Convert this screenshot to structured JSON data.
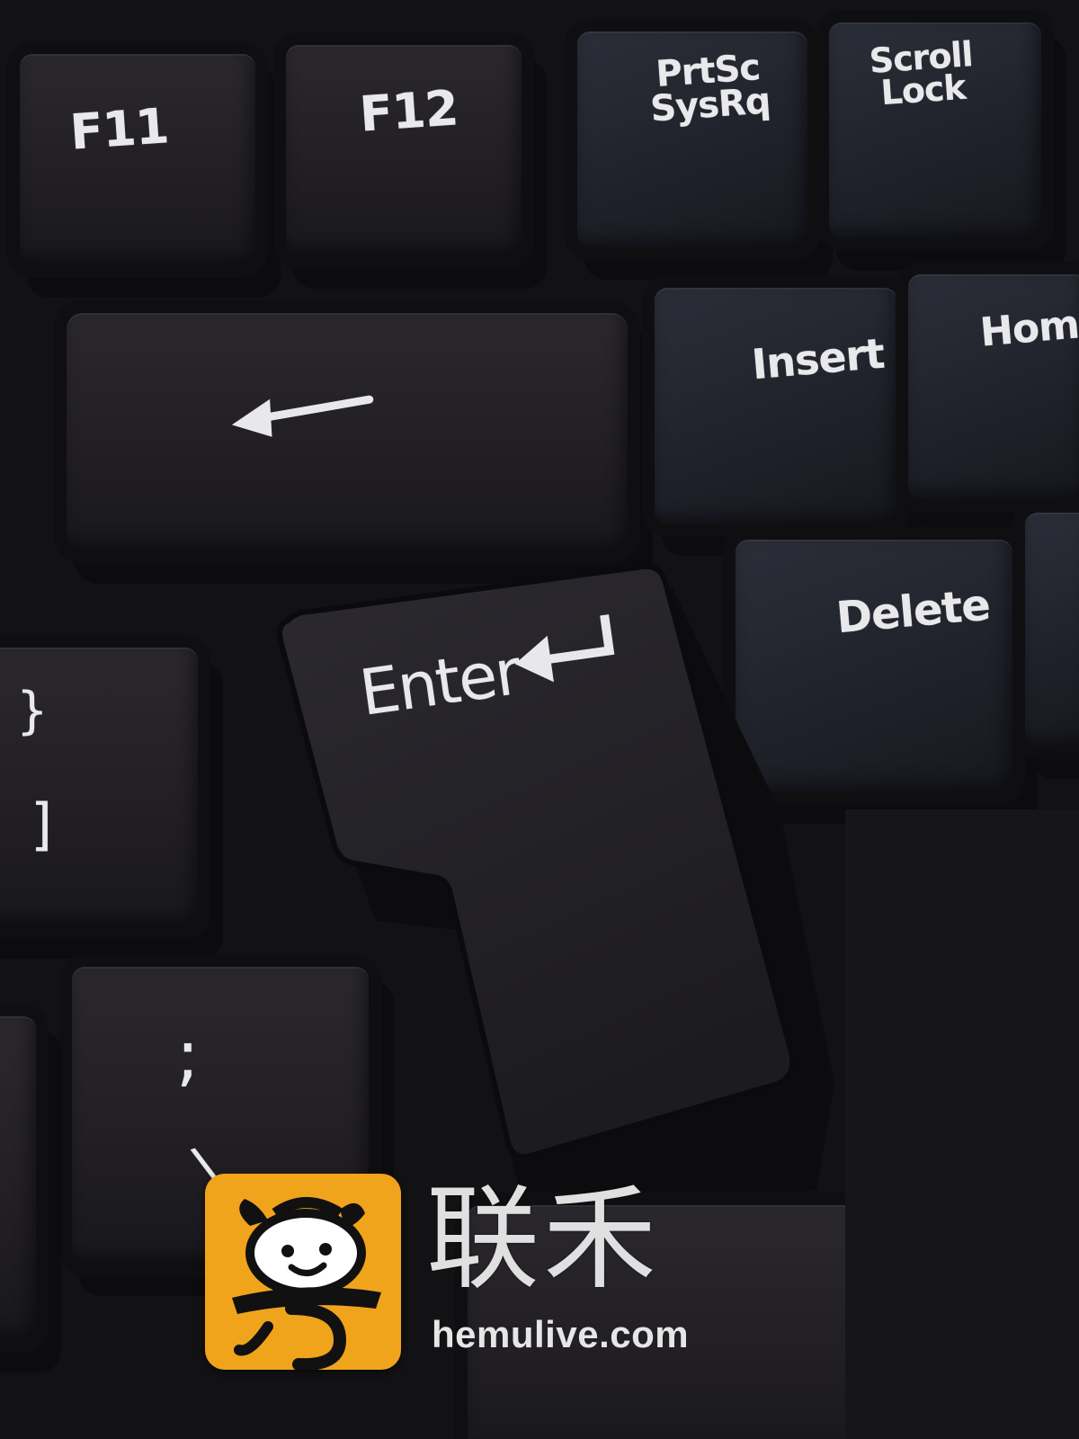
{
  "keyboard": {
    "keys": {
      "f11": "F11",
      "f12": "F12",
      "prtsc_line1": "PrtSc",
      "prtsc_line2": "SysRq",
      "scroll_line1": "Scroll",
      "scroll_line2": "Lock",
      "backspace_symbol": "←",
      "enter": "Enter",
      "enter_symbol": "↵",
      "insert": "Insert",
      "home": "Hom",
      "delete": "Delete",
      "brace": "}",
      "bracket": "]",
      "semicolon": ";",
      "backslash": "\\"
    }
  },
  "watermark": {
    "brand_cn": "联禾",
    "url": "hemulive.com",
    "logo_icon": "cow-face-mascot-icon",
    "logo_color": "#f0a41c"
  }
}
